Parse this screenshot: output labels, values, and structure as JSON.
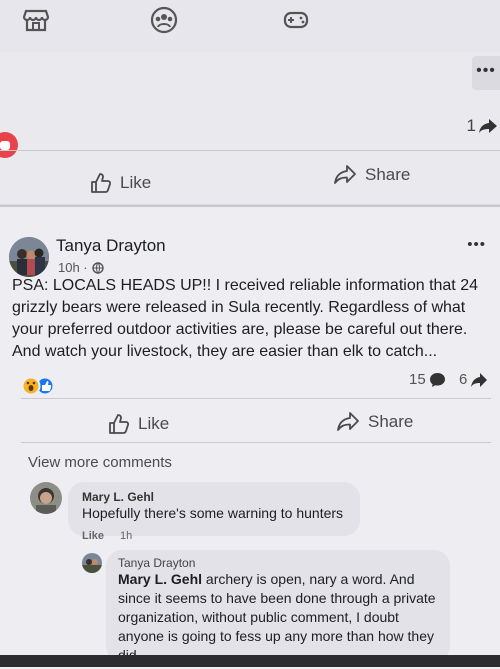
{
  "top_nav": {
    "icons": [
      "marketplace-icon",
      "groups-icon",
      "gaming-icon"
    ]
  },
  "previous_post": {
    "more_label": "•••",
    "share_count": "1",
    "like_label": "Like",
    "share_label": "Share"
  },
  "post": {
    "author": "Tanya Drayton",
    "time": "10h ·",
    "more_label": "•••",
    "text": "PSA: LOCALS HEADS UP!! I received reliable information that 24 grizzly bears were released in Sula recently. Regardless of what your preferred outdoor activities are, please be careful out there. And watch your livestock, they are easier than elk to catch...",
    "comment_count": "15",
    "share_count": "6",
    "like_label": "Like",
    "share_label": "Share",
    "reaction_colors": {
      "wow": "#f7b125",
      "like": "#1877f2",
      "heart": "#e8434b"
    }
  },
  "comments": {
    "view_more": "View more comments",
    "items": [
      {
        "author": "Mary L. Gehl",
        "text": "Hopefully there's some warning to hunters",
        "like_label": "Like",
        "time": "1h"
      }
    ],
    "reply": {
      "author": "Tanya Drayton",
      "mention": "Mary L. Gehl",
      "text": " archery is open, nary a word. And since it seems to have been done through a private organization, without public comment, I doubt anyone is going to fess up any more than how they did."
    }
  }
}
